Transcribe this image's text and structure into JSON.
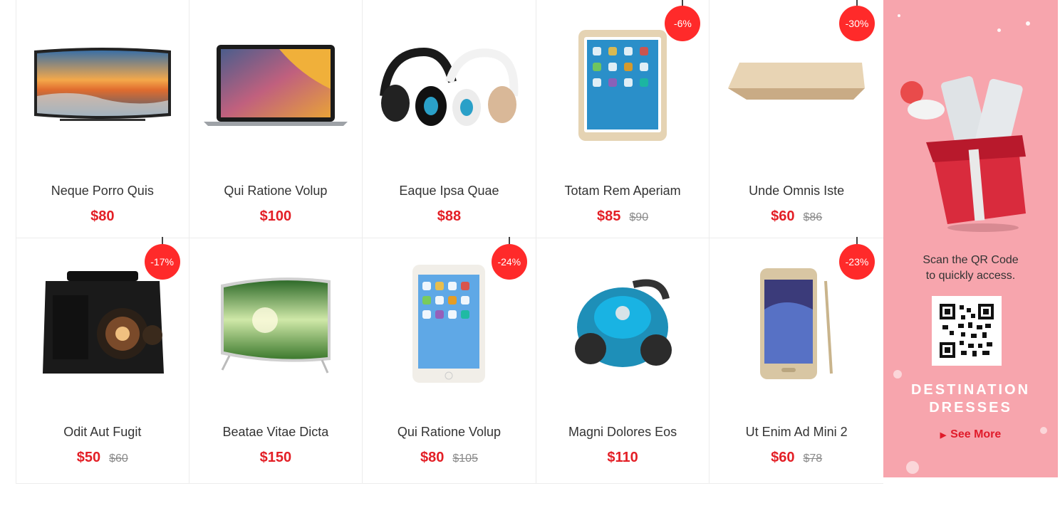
{
  "products": [
    {
      "name": "Neque Porro Quis",
      "price": "$80"
    },
    {
      "name": "Qui Ratione Volup",
      "price": "$100"
    },
    {
      "name": "Eaque Ipsa Quae",
      "price": "$88"
    },
    {
      "name": "Totam Rem Aperiam",
      "price": "$85",
      "old_price": "$90",
      "badge": "-6%"
    },
    {
      "name": "Unde Omnis Iste",
      "price": "$60",
      "old_price": "$86",
      "badge": "-30%"
    },
    {
      "name": "Odit Aut Fugit",
      "price": "$50",
      "old_price": "$60",
      "badge": "-17%"
    },
    {
      "name": "Beatae Vitae Dicta",
      "price": "$150"
    },
    {
      "name": "Qui Ratione Volup",
      "price": "$80",
      "old_price": "$105",
      "badge": "-24%"
    },
    {
      "name": "Magni Dolores Eos",
      "price": "$110"
    },
    {
      "name": "Ut Enim Ad Mini 2",
      "price": "$60",
      "old_price": "$78",
      "badge": "-23%"
    }
  ],
  "promo": {
    "scan_line1": "Scan the QR Code",
    "scan_line2": "to quickly access.",
    "title_line1": "DESTINATION",
    "title_line2": "DRESSES",
    "see_more": "See More",
    "bg_color": "#f7a5ad",
    "accent": "#e01b2a"
  },
  "colors": {
    "price": "#e31f26",
    "badge": "#ff2a2a",
    "old_price": "#8a8a8a"
  }
}
